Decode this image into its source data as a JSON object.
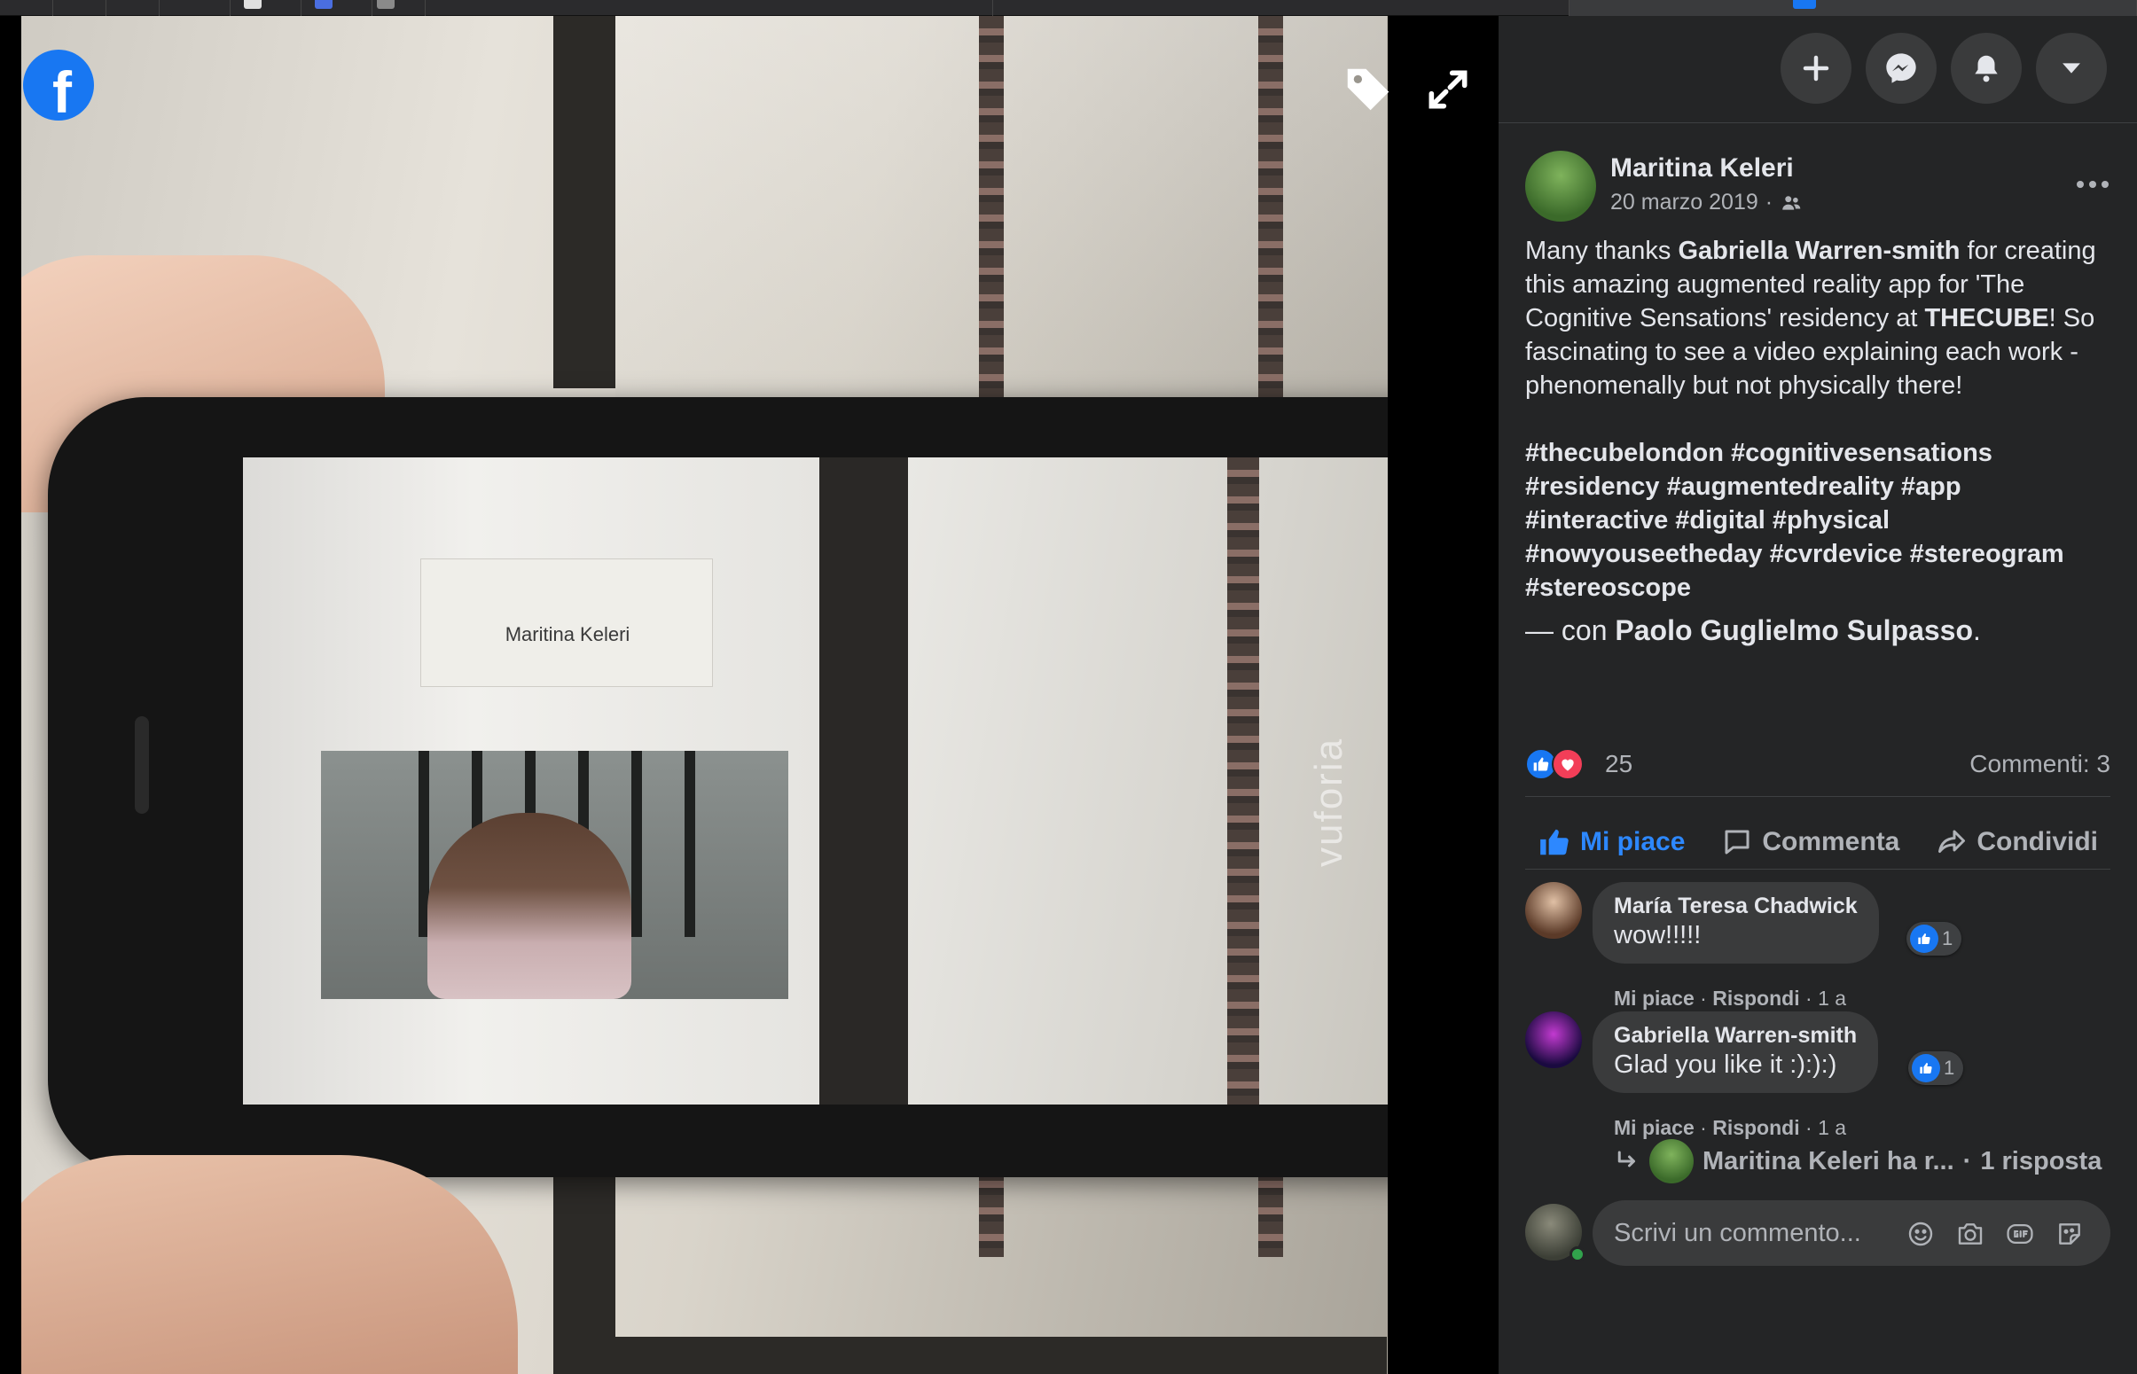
{
  "viewer": {
    "photo_label_text": "Maritina Keleri",
    "watermark": "vuforia",
    "logo_letter": "f"
  },
  "header": {
    "buttons": [
      {
        "icon": "plus-icon"
      },
      {
        "icon": "messenger-icon"
      },
      {
        "icon": "bell-icon"
      },
      {
        "icon": "caret-down-icon"
      }
    ]
  },
  "post": {
    "author": "Maritina Keleri",
    "date": "20 marzo 2019",
    "separator": "·",
    "body": {
      "p1": "Many thanks ",
      "tag1": "Gabriella Warren-smith",
      "p2": " for creating this amazing augmented reality app for 'The Cognitive Sensations' residency at ",
      "tag2": "THECUBE",
      "p3": "! So fascinating to see a video explaining each work - phenomenally but not physically there!"
    },
    "hashtags": "#thecubelondon #cognitivesensations #residency #augmentedreality #app #interactive #digital #physical #nowyouseetheday #cvrdevice #stereogram #stereoscope",
    "with_prefix": "— con ",
    "with_name": "Paolo Guglielmo Sulpasso",
    "with_suffix": "."
  },
  "reactions": {
    "count": "25",
    "comments_label": "Commenti: 3"
  },
  "actions": {
    "like": "Mi piace",
    "comment": "Commenta",
    "share": "Condividi"
  },
  "comments": [
    {
      "name": "María Teresa Chadwick",
      "text": "wow!!!!!",
      "likes": "1",
      "like_label": "Mi piace",
      "reply_label": "Rispondi",
      "age": "1 a"
    },
    {
      "name": "Gabriella Warren-smith",
      "text": "Glad you like it :):):)",
      "likes": "1",
      "like_label": "Mi piace",
      "reply_label": "Rispondi",
      "age": "1 a"
    }
  ],
  "reply_summary": {
    "author_text": "Maritina Keleri ha r...",
    "separator": "·",
    "count_text": "1 risposta"
  },
  "composer": {
    "placeholder": "Scrivi un commento..."
  },
  "colors": {
    "brand": "#1877f2",
    "panel_bg": "#242526",
    "bubble_bg": "#3a3b3c",
    "liked_text": "#2d88ff",
    "love": "#f33e58",
    "online": "#31a24c"
  }
}
